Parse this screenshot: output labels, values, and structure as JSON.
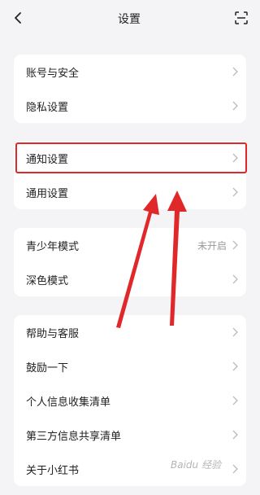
{
  "header": {
    "title": "设置"
  },
  "groups": [
    {
      "items": [
        {
          "label": "账号与安全"
        },
        {
          "label": "隐私设置"
        }
      ]
    },
    {
      "items": [
        {
          "label": "通知设置"
        },
        {
          "label": "通用设置"
        }
      ]
    },
    {
      "items": [
        {
          "label": "青少年模式",
          "value": "未开启"
        },
        {
          "label": "深色模式"
        }
      ]
    },
    {
      "items": [
        {
          "label": "帮助与客服"
        },
        {
          "label": "鼓励一下"
        },
        {
          "label": "个人信息收集清单"
        },
        {
          "label": "第三方信息共享清单"
        },
        {
          "label": "关于小红书"
        }
      ]
    }
  ],
  "watermark": "Baidu 经验",
  "colors": {
    "highlight": "#e0282b",
    "background": "#f4f4f6"
  },
  "icons": {
    "back": "chevron-left-icon",
    "scan": "scan-icon",
    "row": "chevron-right-icon"
  }
}
